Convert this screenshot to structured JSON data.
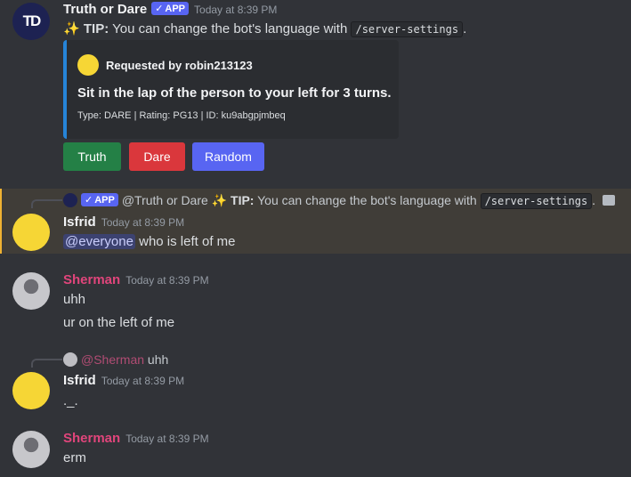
{
  "messages": {
    "bot": {
      "name": "Truth or Dare",
      "badge": "APP",
      "badge_check": "✓",
      "time": "Today at 8:39 PM",
      "tip_icon": "✨",
      "tip_label": "TIP:",
      "tip_text": "You can change the bot's language with",
      "tip_command": "/server-settings",
      "tip_period": ".",
      "avatar_text": "TD",
      "embed": {
        "author": "Requested by robin213123",
        "title": "Sit in the lap of the person to your left for 3 turns.",
        "footer": "Type: DARE | Rating: PG13 | ID: ku9abgpjmbeq",
        "accent": "#2684d8"
      },
      "buttons": [
        {
          "label": "Truth",
          "color": "#248046"
        },
        {
          "label": "Dare",
          "color": "#da373c"
        },
        {
          "label": "Random",
          "color": "#5865f2"
        }
      ]
    },
    "isfrid1": {
      "reply_badge": "APP",
      "reply_author": "@Truth or Dare",
      "reply_tip_label": "TIP:",
      "reply_text": "You can change the bot's language with",
      "reply_command": "/server-settings",
      "reply_period": ".",
      "name": "Isfrid",
      "time": "Today at 8:39 PM",
      "mention": "@everyone",
      "text": "who is left of me"
    },
    "sherman1": {
      "name": "Sherman",
      "name_color": "#e0457b",
      "time": "Today at 8:39 PM",
      "line1": "uhh",
      "line2": "ur on the left of me"
    },
    "isfrid2": {
      "reply_author": "@Sherman",
      "reply_text": "uhh",
      "name": "Isfrid",
      "time": "Today at 8:39 PM",
      "text": "._."
    },
    "sherman2": {
      "name": "Sherman",
      "time": "Today at 8:39 PM",
      "text": "erm"
    }
  }
}
